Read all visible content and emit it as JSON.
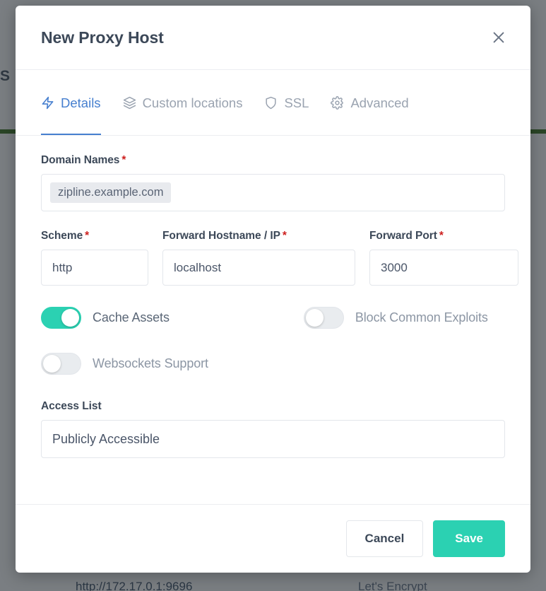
{
  "background": {
    "sidebar_letter": "S",
    "row_url": "http://172.17.0.1:9696",
    "row_cert": "Let's Encrypt",
    "accent_green": "#2e6b0e"
  },
  "modal": {
    "title": "New Proxy Host",
    "close_icon": "close-icon",
    "tabs": [
      {
        "label": "Details",
        "icon": "zap-icon",
        "active": true
      },
      {
        "label": "Custom locations",
        "icon": "layers-icon",
        "active": false
      },
      {
        "label": "SSL",
        "icon": "shield-icon",
        "active": false
      },
      {
        "label": "Advanced",
        "icon": "gear-icon",
        "active": false
      }
    ],
    "fields": {
      "domain_names": {
        "label": "Domain Names",
        "required": true,
        "tags": [
          "zipline.example.com"
        ],
        "placeholder": ""
      },
      "scheme": {
        "label": "Scheme",
        "required": true,
        "value": "http",
        "placeholder": "http"
      },
      "forward_hostname": {
        "label": "Forward Hostname / IP",
        "required": true,
        "value": "localhost",
        "placeholder": "localhost"
      },
      "forward_port": {
        "label": "Forward Port",
        "required": true,
        "value": "3000",
        "placeholder": "3000"
      },
      "access_list": {
        "label": "Access List",
        "required": false,
        "value": "Publicly Accessible"
      }
    },
    "toggles": [
      {
        "label": "Cache Assets",
        "on": true
      },
      {
        "label": "Block Common Exploits",
        "on": false
      },
      {
        "label": "Websockets Support",
        "on": false
      }
    ],
    "footer": {
      "cancel_label": "Cancel",
      "save_label": "Save"
    },
    "colors": {
      "accent_blue": "#467fcf",
      "accent_teal": "#2bd1b2",
      "required_red": "#cd201f",
      "text_dark": "#3c4858"
    }
  }
}
